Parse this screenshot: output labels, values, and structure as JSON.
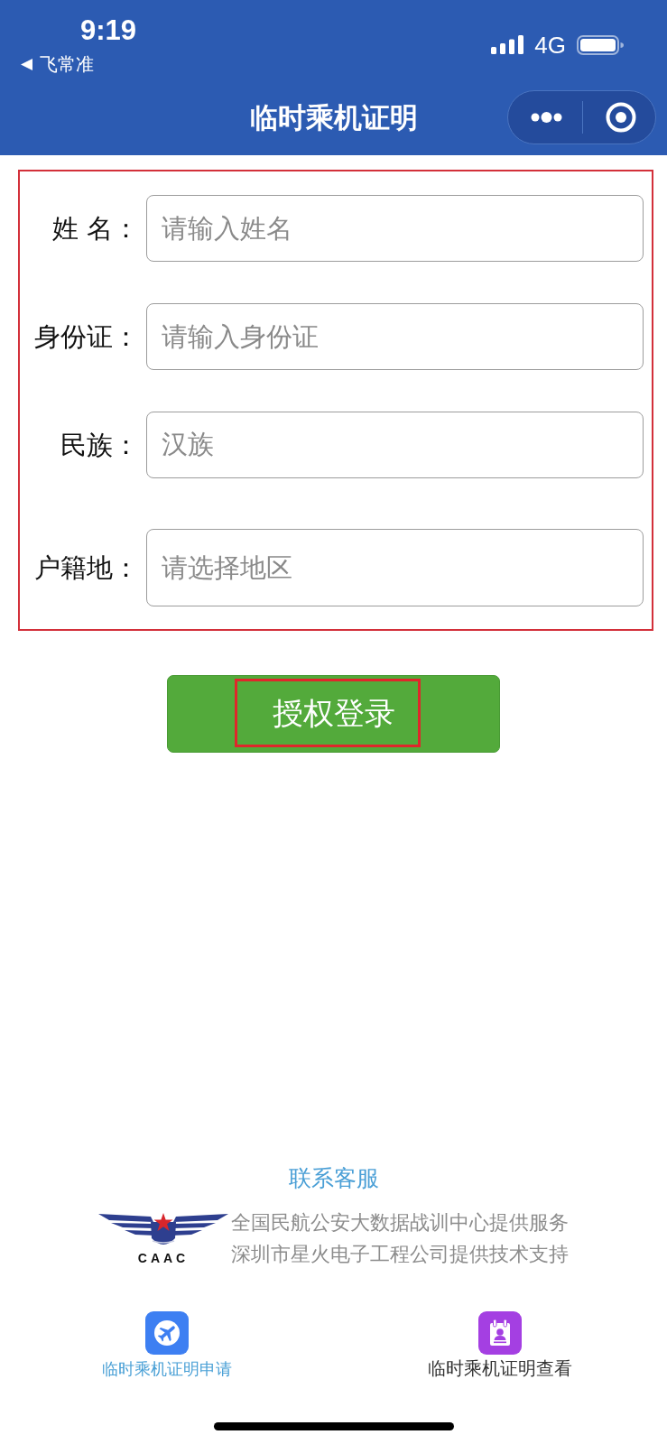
{
  "status_bar": {
    "time": "9:19",
    "back_app": "飞常准",
    "network": "4G"
  },
  "navigation_bar": {
    "title": "临时乘机证明"
  },
  "form": {
    "highlighted": true,
    "fields": [
      {
        "label": "姓 名：",
        "placeholder": "请输入姓名"
      },
      {
        "label": "身份证：",
        "placeholder": "请输入身份证"
      },
      {
        "label": "民族：",
        "value": "汉族"
      },
      {
        "label": "户籍地：",
        "placeholder": "请选择地区"
      }
    ]
  },
  "login_button": {
    "label": "授权登录",
    "highlighted": true
  },
  "footer": {
    "contact_link": "联系客服",
    "logo_text": "CAAC",
    "credits": [
      "全国民航公安大数据战训中心提供服务",
      "深圳市星火电子工程公司提供技术支持"
    ]
  },
  "tab_bar": {
    "tabs": [
      {
        "label": "临时乘机证明申请",
        "selected": true
      },
      {
        "label": "临时乘机证明查看",
        "selected": false
      }
    ]
  }
}
